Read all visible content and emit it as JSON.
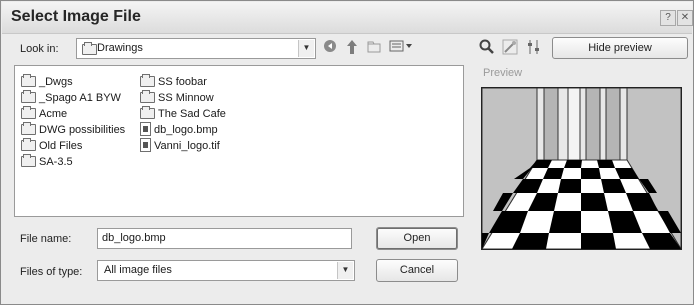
{
  "dialog": {
    "title": "Select Image File",
    "help_glyph": "?",
    "close_glyph": "✕"
  },
  "look_in": {
    "label": "Look in:",
    "value": "Drawings"
  },
  "toolbar": {
    "back_icon": "back-arrow-icon",
    "up_icon": "up-one-level-icon",
    "new_folder_icon": "new-folder-icon",
    "views_icon": "views-menu-icon",
    "find_icon": "find-icon",
    "tools_icon": "tools-icon",
    "options_icon": "options-icon",
    "hide_preview_label": "Hide preview"
  },
  "files": {
    "column1": [
      {
        "name": "_Dwgs",
        "type": "folder"
      },
      {
        "name": "_Spago A1 BYW",
        "type": "folder"
      },
      {
        "name": "Acme",
        "type": "folder"
      },
      {
        "name": "DWG possibilities",
        "type": "folder"
      },
      {
        "name": "Old Files",
        "type": "folder"
      },
      {
        "name": "SA-3.5",
        "type": "folder"
      }
    ],
    "column2": [
      {
        "name": "SS foobar",
        "type": "folder"
      },
      {
        "name": "SS Minnow",
        "type": "folder"
      },
      {
        "name": "The Sad Cafe",
        "type": "folder"
      },
      {
        "name": "db_logo.bmp",
        "type": "image"
      },
      {
        "name": "Vanni_logo.tif",
        "type": "image"
      }
    ]
  },
  "preview": {
    "label": "Preview"
  },
  "file_name": {
    "label": "File name:",
    "value": "db_logo.bmp"
  },
  "files_of_type": {
    "label": "Files of type:",
    "value": "All image files"
  },
  "buttons": {
    "open": "Open",
    "cancel": "Cancel"
  },
  "colors": {
    "dialog_bg": "#ececec",
    "preview_floor_dark": "#000000",
    "preview_wall": "#b8b8b8"
  }
}
